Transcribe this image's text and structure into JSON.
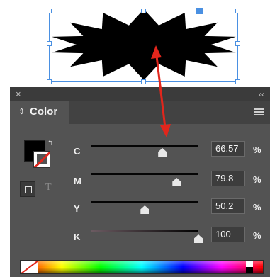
{
  "panel": {
    "tab_title": "Color",
    "colors": {
      "accent_red": "#e1261c",
      "selection_blue": "#4a90e2"
    }
  },
  "sliders": [
    {
      "label": "C",
      "value": "66.57",
      "unit": "%",
      "level": 0.6657
    },
    {
      "label": "M",
      "value": "79.8",
      "unit": "%",
      "level": 0.798
    },
    {
      "label": "Y",
      "value": "50.2",
      "unit": "%",
      "level": 0.502
    },
    {
      "label": "K",
      "value": "100",
      "unit": "%",
      "level": 1.0
    }
  ],
  "icons": {
    "close": "close-icon",
    "collapse": "double-chevron-icon",
    "menu": "hamburger-menu-icon",
    "tab_arrows": "up-down-arrows-icon",
    "swap": "swap-fill-stroke-icon"
  }
}
